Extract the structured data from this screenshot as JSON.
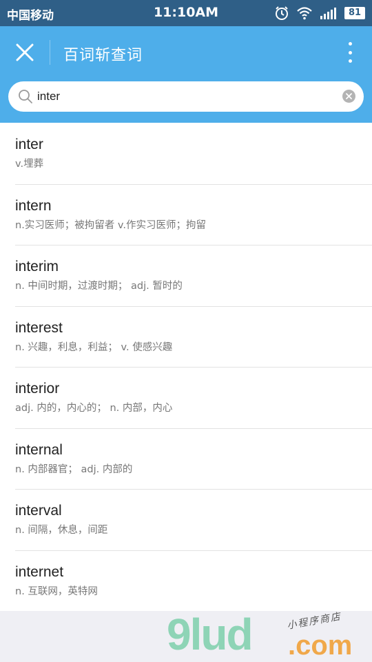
{
  "status_bar": {
    "carrier": "中国移动",
    "time": "11:10AM",
    "battery": "81",
    "icons": [
      "alarm-icon",
      "wifi-icon",
      "signal-icon",
      "battery-icon"
    ]
  },
  "header": {
    "title": "百词斩查词",
    "close_icon": "close-icon",
    "more_icon": "more-vertical-icon",
    "background": "#4eaeea"
  },
  "search": {
    "value": "inter",
    "search_icon": "search-icon",
    "clear_icon": "clear-icon"
  },
  "results": [
    {
      "word": "inter",
      "meaning": "v.埋葬"
    },
    {
      "word": "intern",
      "meaning": "n.实习医师；被拘留者 v.作实习医师；拘留"
    },
    {
      "word": "interim",
      "meaning": "n. 中间时期，过渡时期； adj. 暂时的"
    },
    {
      "word": "interest",
      "meaning": "n. 兴趣，利息，利益； v. 使感兴趣"
    },
    {
      "word": "interior",
      "meaning": "adj. 内的，内心的； n. 内部，内心"
    },
    {
      "word": "internal",
      "meaning": "n. 内部器官； adj. 内部的"
    },
    {
      "word": "interval",
      "meaning": "n. 间隔，休息，间距"
    },
    {
      "word": "internet",
      "meaning": "n. 互联网，英特网"
    }
  ],
  "watermark": {
    "logo": "9lud",
    "suffix": ".com",
    "script": "小程序商店"
  }
}
